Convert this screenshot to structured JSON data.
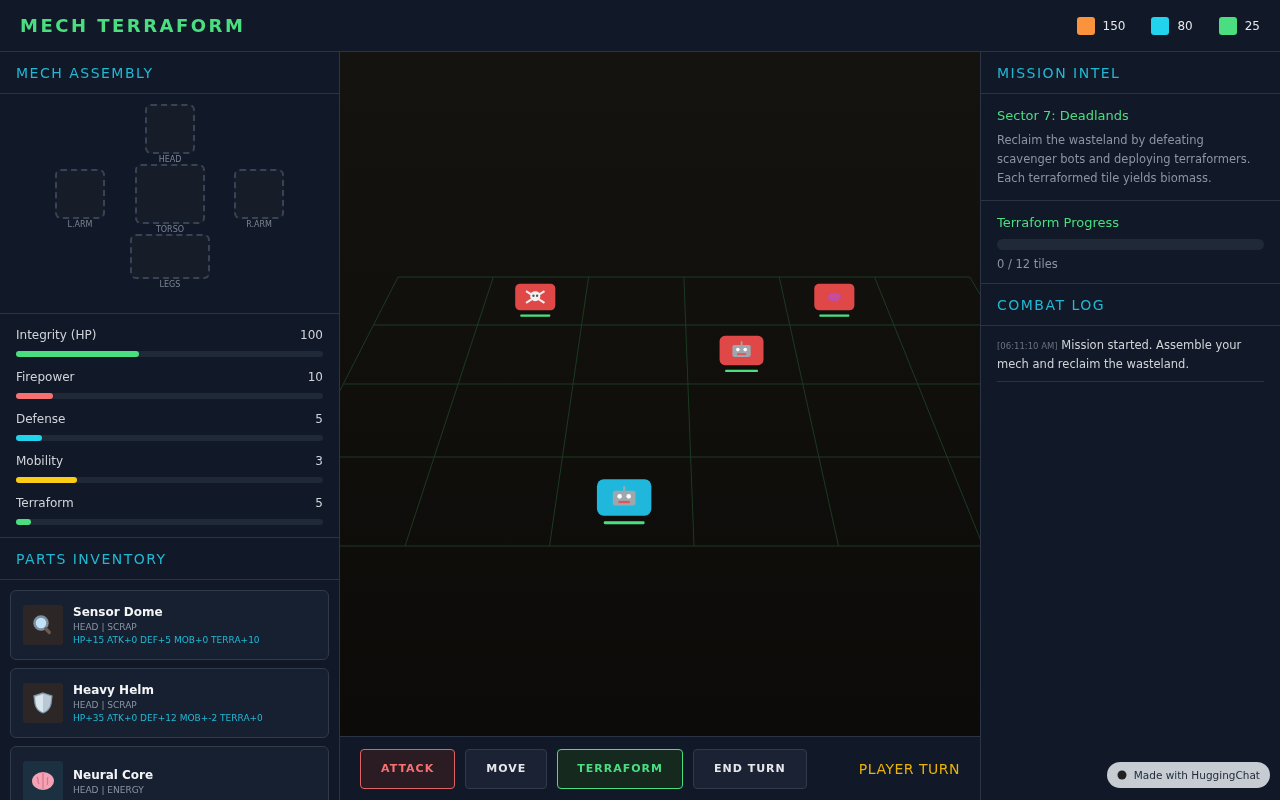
{
  "header": {
    "title": "MECH TERRAFORM",
    "resources": [
      {
        "color": "#fb923c",
        "value": "150"
      },
      {
        "color": "#22d3ee",
        "value": "80"
      },
      {
        "color": "#4ade80",
        "value": "25"
      }
    ]
  },
  "assembly": {
    "title": "MECH ASSEMBLY",
    "slots": [
      {
        "kind": "head",
        "label": "HEAD"
      },
      {
        "kind": "larm",
        "label": "L.ARM"
      },
      {
        "kind": "torso",
        "label": "TORSO"
      },
      {
        "kind": "rarm",
        "label": "R.ARM"
      },
      {
        "kind": "legs",
        "label": "LEGS"
      }
    ]
  },
  "stats": [
    {
      "label": "Integrity (HP)",
      "value": "100",
      "level": 0.4,
      "color": "#4ade80"
    },
    {
      "label": "Firepower",
      "value": "10",
      "level": 0.12,
      "color": "#f87171"
    },
    {
      "label": "Defense",
      "value": "5",
      "level": 0.085,
      "color": "#22d3ee"
    },
    {
      "label": "Mobility",
      "value": "3",
      "level": 0.2,
      "color": "#facc15"
    },
    {
      "label": "Terraform",
      "value": "5",
      "level": 0.05,
      "color": "#4ade80"
    }
  ],
  "inventory": {
    "title": "PARTS INVENTORY",
    "parts": [
      {
        "name": "Sensor Dome",
        "meta": "HEAD | SCRAP",
        "stats": "HP+15 ATK+0 DEF+5 MOB+0 TERRA+10"
      },
      {
        "name": "Heavy Helm",
        "meta": "HEAD | SCRAP",
        "stats": "HP+35 ATK+0 DEF+12 MOB+-2 TERRA+0"
      },
      {
        "name": "Neural Core",
        "meta": "HEAD | ENERGY"
      }
    ]
  },
  "board": {
    "units": [
      {
        "kind": "enemy",
        "level": 1
      },
      {
        "kind": "enemy",
        "level": 1
      },
      {
        "kind": "enemy",
        "level": 1
      },
      {
        "kind": "player",
        "level": 1
      }
    ]
  },
  "actions": [
    {
      "kind": "attack",
      "label": "ATTACK"
    },
    {
      "kind": "move",
      "label": "MOVE"
    },
    {
      "kind": "terraform",
      "label": "TERRAFORM"
    },
    {
      "kind": "end",
      "label": "END TURN"
    }
  ],
  "turn": "PLAYER TURN",
  "intel": {
    "title": "MISSION INTEL",
    "sector": "Sector 7: Deadlands",
    "description": "Reclaim the wasteland by defeating scavenger bots and deploying terraformers. Each terraformed tile yields biomass.",
    "progress_title": "Terraform Progress",
    "progress": {
      "level": 0
    },
    "progress_text": "0 / 12 tiles"
  },
  "log": {
    "title": "COMBAT LOG",
    "entries": [
      {
        "time": "[06:11:10 AM]",
        "text": "Mission started. Assemble your mech and reclaim the wasteland."
      }
    ]
  },
  "badge": "Made with HuggingChat"
}
